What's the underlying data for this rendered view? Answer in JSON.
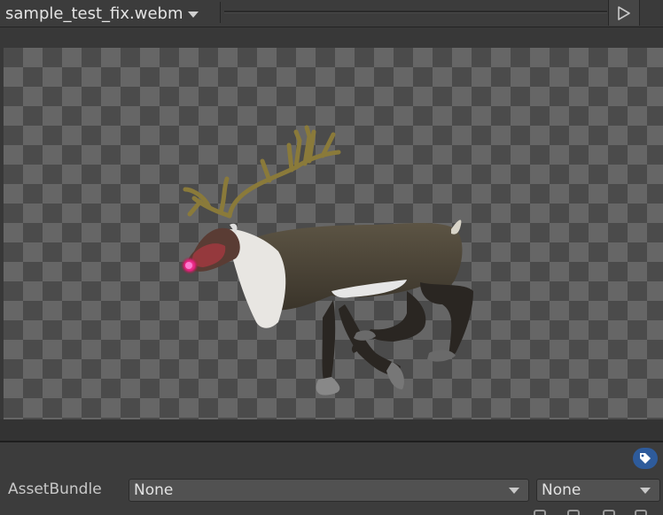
{
  "header": {
    "title": "sample_test_fix.webm"
  },
  "icons": {
    "play": "play-icon",
    "dropdown": "chevron-down-icon",
    "tag": "tag-icon"
  },
  "colors": {
    "tag_badge": "#2e5b9b",
    "nose_glow": "#ff2a8a"
  },
  "asset_bundle": {
    "label": "AssetBundle",
    "bundle_value": "None",
    "variant_value": "None"
  }
}
